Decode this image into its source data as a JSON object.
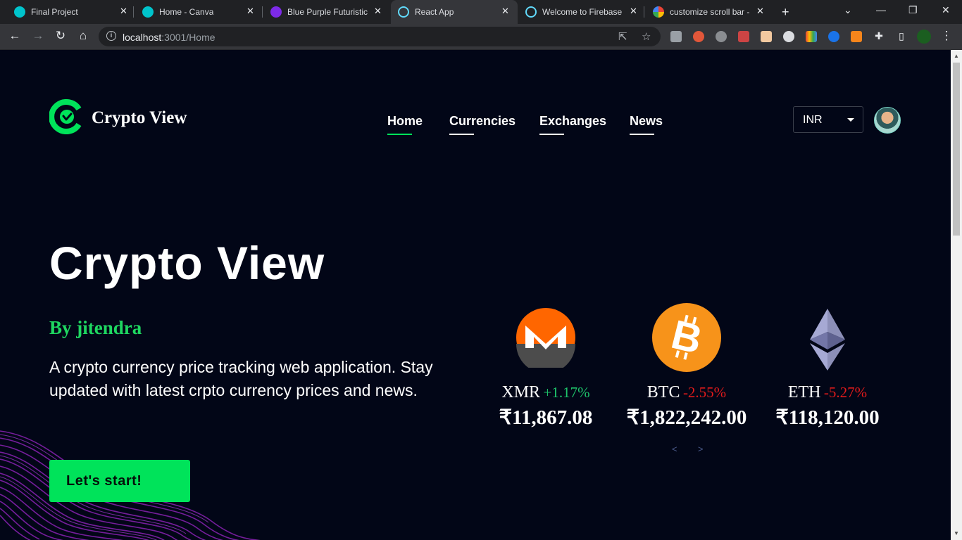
{
  "browser": {
    "tabs": [
      {
        "title": "Final Project",
        "favicon_color": "#00c4cc"
      },
      {
        "title": "Home - Canva",
        "favicon_color": "#00c4cc"
      },
      {
        "title": "Blue Purple Futuristic",
        "favicon_color": "#7d2ae8"
      },
      {
        "title": "React App",
        "favicon_color": "#61dafb"
      },
      {
        "title": "Welcome to Firebase",
        "favicon_color": "#61dafb"
      },
      {
        "title": "customize scroll bar -",
        "favicon_color": "#4285f4"
      }
    ],
    "active_tab_index": 3,
    "url_host": "localhost",
    "url_rest": ":3001/Home"
  },
  "site": {
    "logo_text": "Crypto View",
    "nav": [
      "Home",
      "Currencies",
      "Exchanges",
      "News"
    ],
    "active_nav": "Home",
    "currency": "INR",
    "brand_color": "#00e35a"
  },
  "hero": {
    "title": "Crypto View",
    "byline": "By jitendra",
    "description": "A crypto currency price tracking web application. Stay updated with latest crpto currency prices and news.",
    "cta": "Let's start!"
  },
  "coins": [
    {
      "symbol": "XMR",
      "change": "+1.17%",
      "direction": "up",
      "price": "₹11,867.08",
      "icon": "monero-icon"
    },
    {
      "symbol": "BTC",
      "change": "-2.55%",
      "direction": "down",
      "price": "₹1,822,242.00",
      "icon": "bitcoin-icon"
    },
    {
      "symbol": "ETH",
      "change": "-5.27%",
      "direction": "down",
      "price": "₹118,120.00",
      "icon": "ethereum-icon"
    }
  ],
  "carousel": {
    "prev": "<",
    "next": ">"
  }
}
